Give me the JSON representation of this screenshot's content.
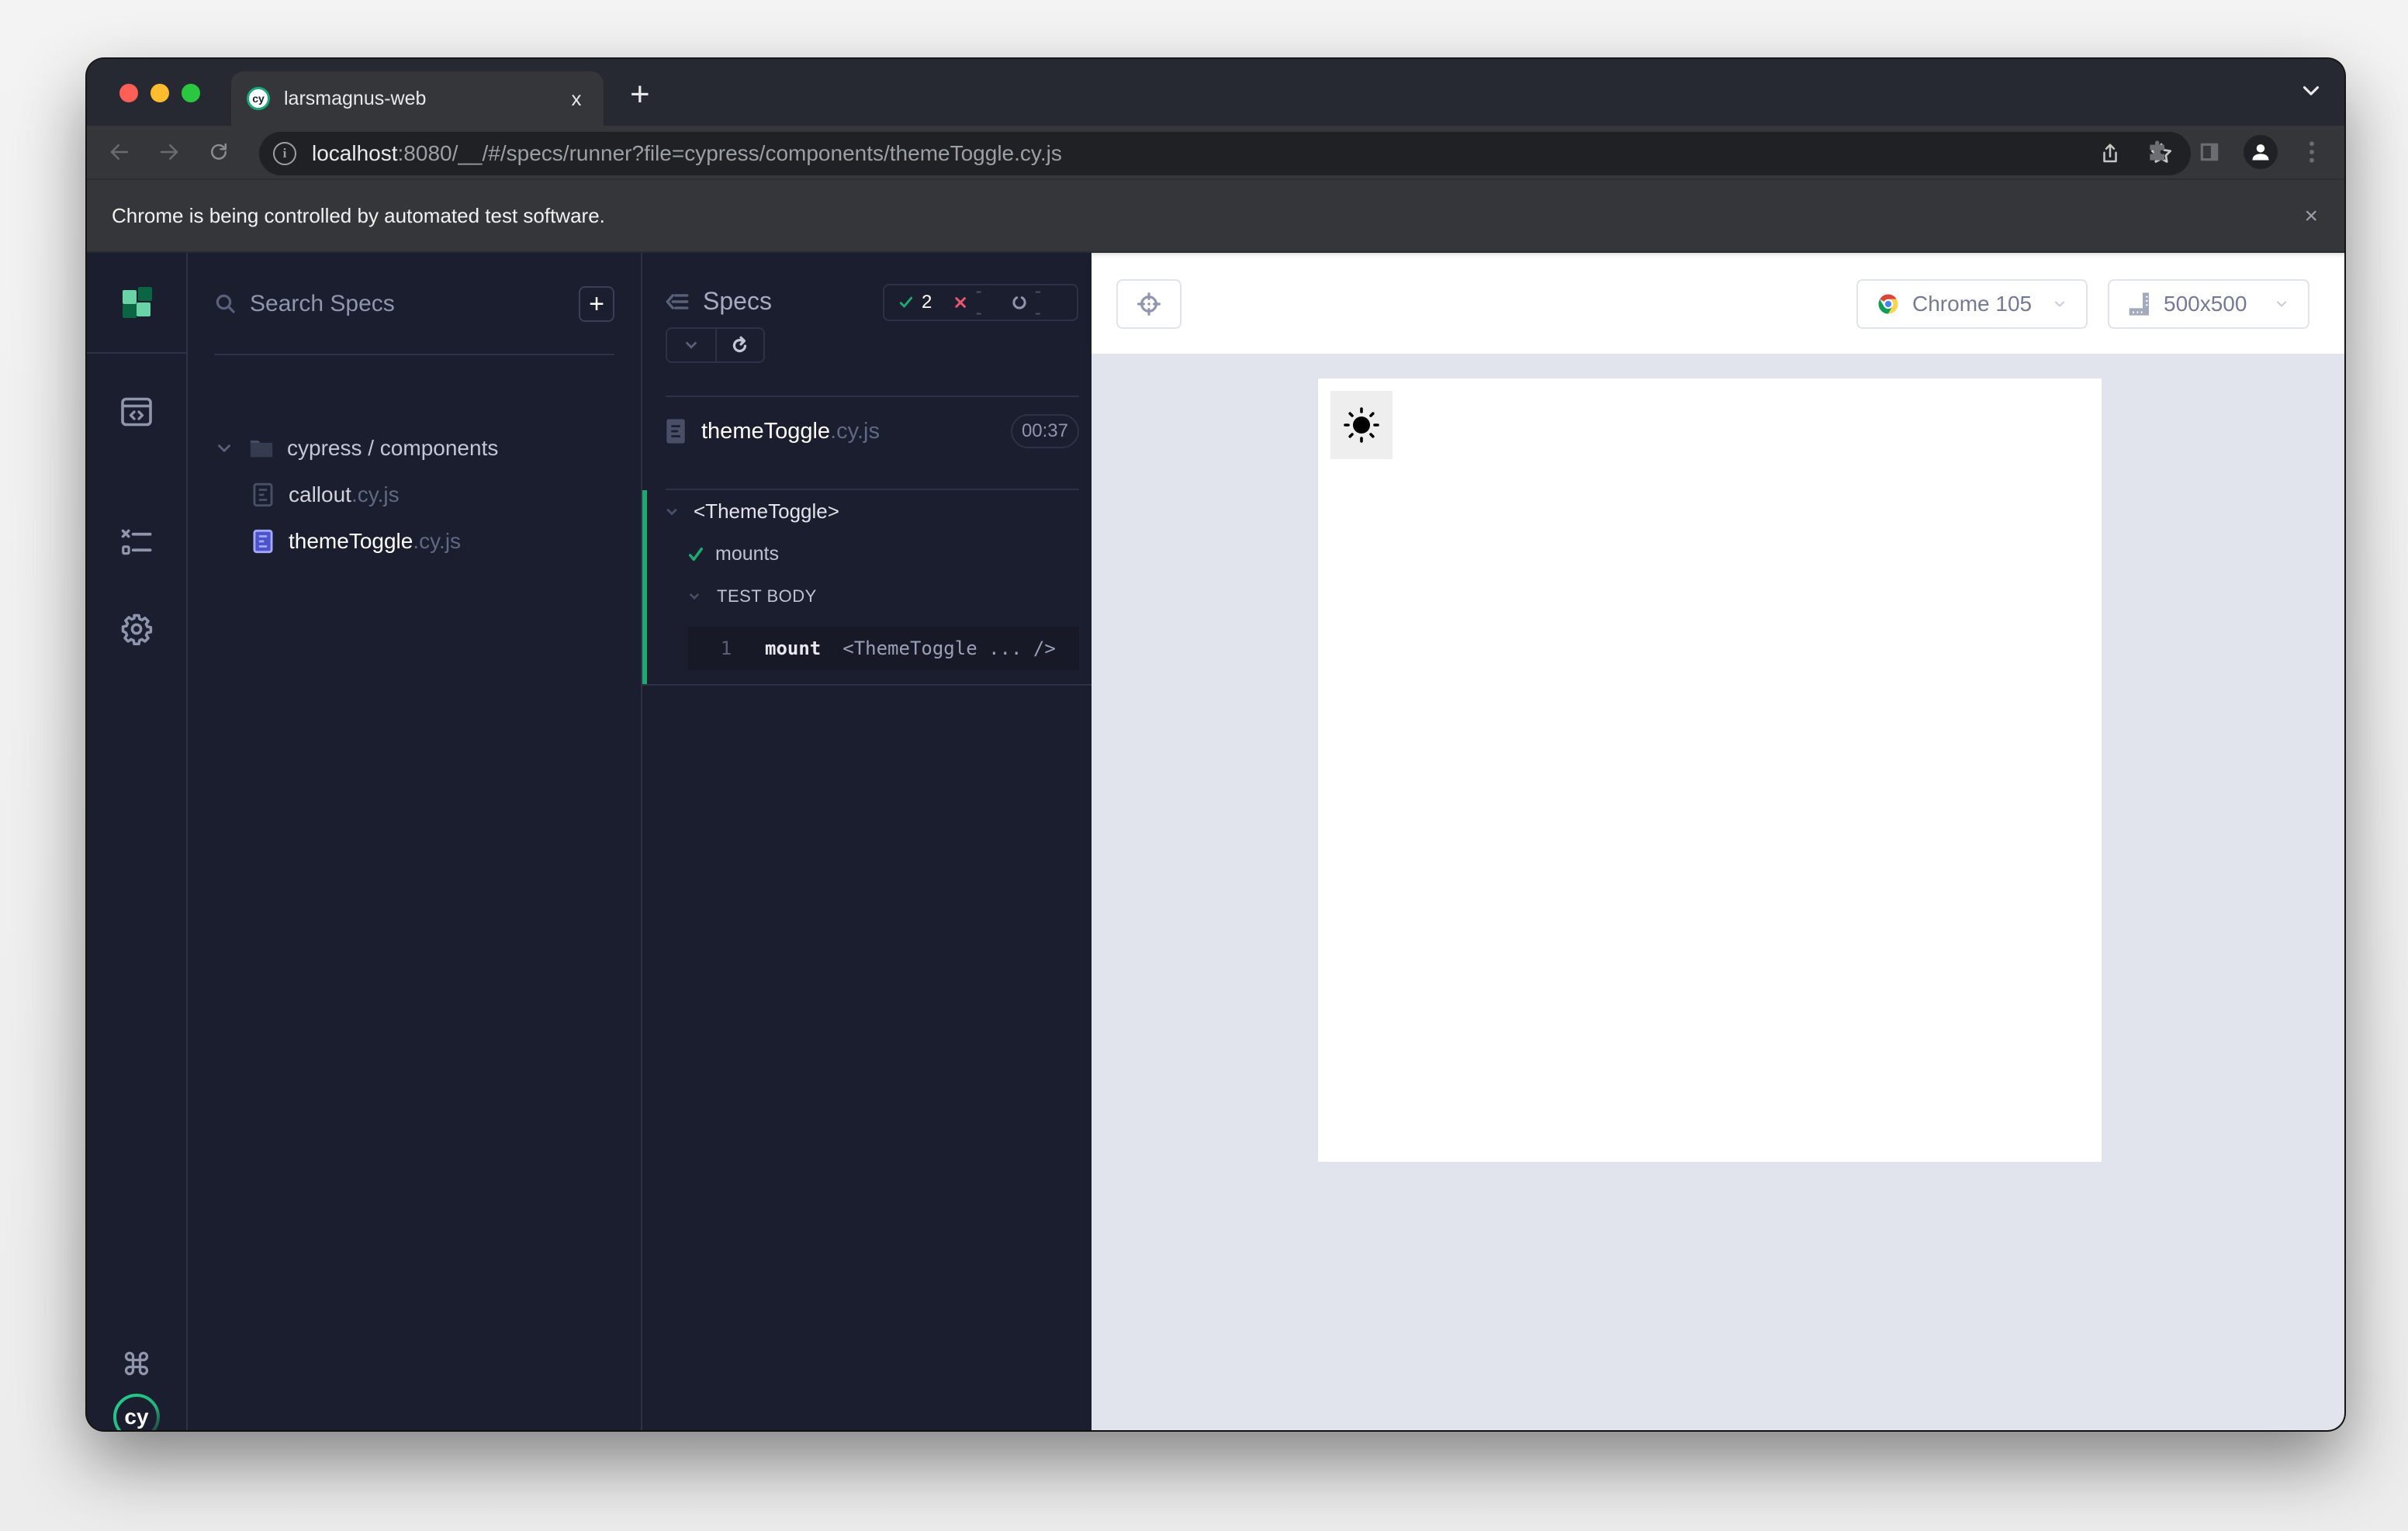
{
  "browser": {
    "tab_title": "larsmagnus-web",
    "tab_favicon_text": "cy",
    "close_tab_glyph": "x",
    "new_tab_glyph": "+",
    "url_host": "localhost",
    "url_rest": ":8080/__/#/specs/runner?file=cypress/components/themeToggle.cy.js",
    "info_glyph": "i",
    "infobar_text": "Chrome is being controlled by automated test software.",
    "infobar_close": "×",
    "icons": [
      "back-icon",
      "forward-icon",
      "reload-icon",
      "share-icon",
      "bookmark-star-icon",
      "extensions-icon",
      "side-panel-icon",
      "profile-icon",
      "more-menu-icon",
      "tab-search-icon"
    ]
  },
  "sidenav": {
    "items": [
      {
        "name": "specs",
        "icon": "code-window-icon"
      },
      {
        "name": "runs",
        "icon": "list-checks-icon",
        "active": true
      },
      {
        "name": "settings",
        "icon": "gear-icon"
      }
    ],
    "bottom": [
      {
        "name": "keyboard-shortcuts",
        "icon": "command-key-icon"
      },
      {
        "name": "cypress-logo",
        "icon": "cypress-logo-icon",
        "text": "cy"
      }
    ]
  },
  "speclist": {
    "search_placeholder": "Search Specs",
    "add_label": "+",
    "directory": "cypress / components",
    "files": [
      {
        "name": "callout",
        "ext": ".cy.js",
        "active": false
      },
      {
        "name": "themeToggle",
        "ext": ".cy.js",
        "active": true
      }
    ]
  },
  "reporter": {
    "title": "Specs",
    "stats": {
      "passed": "2",
      "failed": "--",
      "pending": "--"
    },
    "spec_file": {
      "name": "themeToggle",
      "ext": ".cy.js",
      "duration": "00:37"
    },
    "suite": {
      "title": "<ThemeToggle>",
      "tests": [
        {
          "title": "mounts",
          "state": "passed"
        }
      ],
      "body_label": "TEST BODY",
      "commands": [
        {
          "number": "1",
          "name": "mount",
          "message": "<ThemeToggle ... />"
        }
      ]
    }
  },
  "aut": {
    "browser_label": "Chrome 105",
    "viewport_label": "500x500",
    "component": {
      "name": "theme-toggle",
      "icon": "sun-icon"
    }
  },
  "colors": {
    "passed": "#1fa971",
    "failed": "#e45770",
    "active": "#a3a8fb",
    "app_bg": "#1b1e2e",
    "aut_bg": "#e1e3ed"
  }
}
